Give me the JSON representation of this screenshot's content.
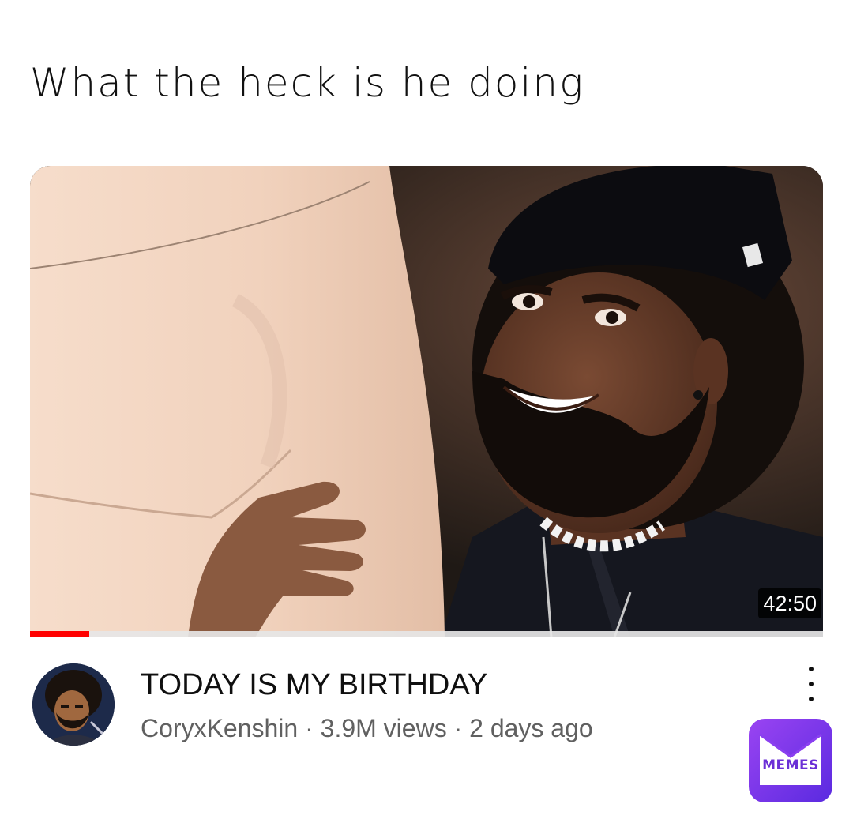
{
  "post": {
    "caption": "What the heck is he doing"
  },
  "video": {
    "title": "TODAY IS MY BIRTHDAY",
    "channel": "CoryxKenshin",
    "views": "3.9M views",
    "uploaded": "2 days ago",
    "separator": " · ",
    "duration": "42:50",
    "progress_fraction": 0.075
  },
  "colors": {
    "progress": "#ff0000",
    "title": "#0f0f0f",
    "meta": "#606060",
    "logo_gradient_start": "#8a3ff0",
    "logo_gradient_end": "#5b2be0"
  },
  "icons": {
    "more": "vertical-ellipsis-icon",
    "logo": "memes-envelope-logo"
  },
  "watermark": {
    "text": "MEMES"
  }
}
